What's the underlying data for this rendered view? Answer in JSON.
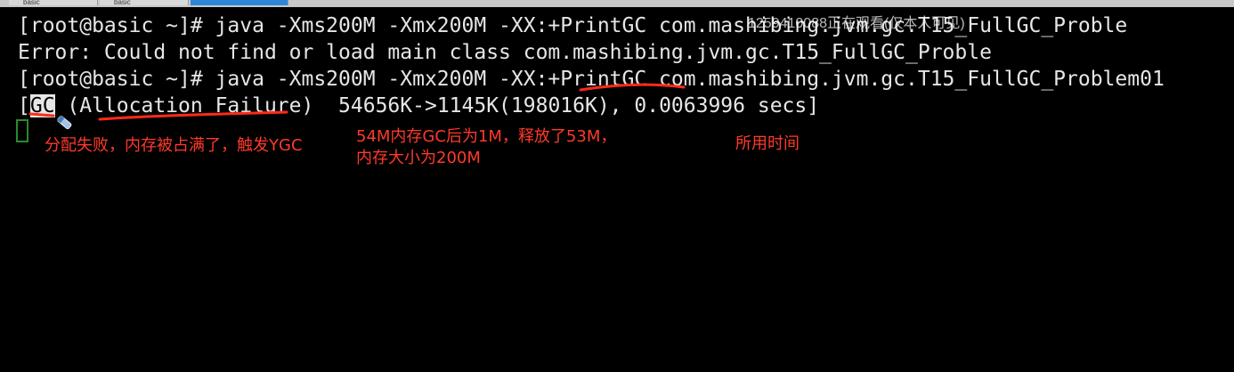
{
  "colors": {
    "background": "#000000",
    "terminal_text": "#e6e6e6",
    "annotation": "#ff3a2a",
    "cursor": "#2a8a2a",
    "active_tab": "#2e86d8"
  },
  "tabs": [
    {
      "label": "basic"
    },
    {
      "label": "basic"
    },
    {
      "label": "",
      "active": true
    }
  ],
  "terminal": {
    "line1": "[root@basic ~]# java -Xms200M -Xmx200M -XX:+PrintGC com.mashibing.jvm.gc.T15_FullGC_Proble",
    "line2": "Error: Could not find or load main class com.mashibing.jvm.gc.T15_FullGC_Proble",
    "line3": "[root@basic ~]# java -Xms200M -Xmx200M -XX:+PrintGC com.mashibing.jvm.gc.T15_FullGC_Problem01",
    "line4_open": "[",
    "line4_gc": "GC",
    "line4_rest": " (Allocation Failure)  54656K->1145K(198016K), 0.0063996 secs]"
  },
  "watermark": "1259410088正在观看(仅本人可见)",
  "annotations": {
    "gc_reason": "分配失败，内存被占满了，触发YGC",
    "memory_change": "54M内存GC后为1M，释放了53M，\n内存大小为200M",
    "time_used": "所用时间"
  },
  "icons": {
    "cursor": "terminal-cursor",
    "pen": "pen-icon"
  }
}
